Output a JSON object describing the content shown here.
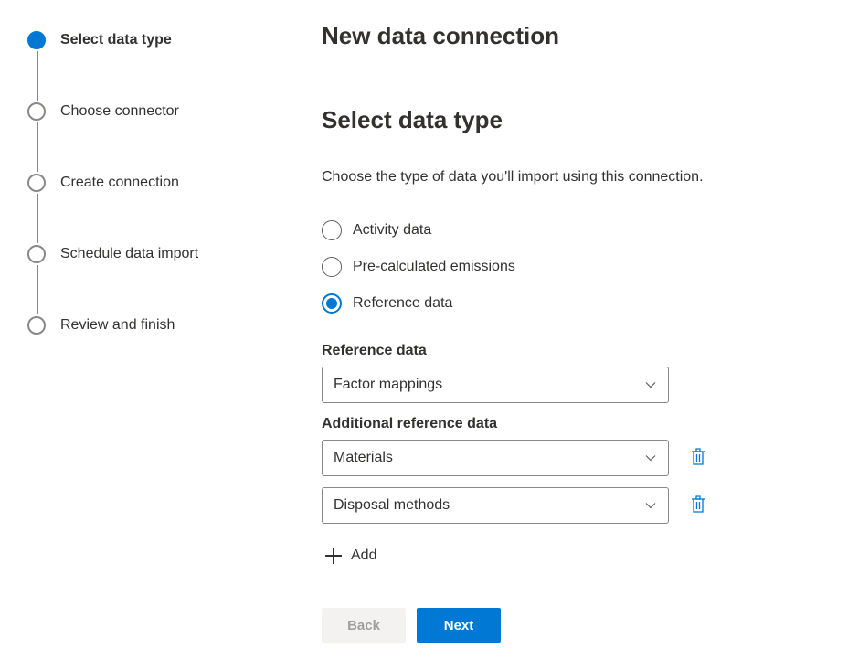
{
  "header": {
    "title": "New data connection"
  },
  "steps": [
    {
      "label": "Select data type",
      "current": true
    },
    {
      "label": "Choose connector",
      "current": false
    },
    {
      "label": "Create connection",
      "current": false
    },
    {
      "label": "Schedule data import",
      "current": false
    },
    {
      "label": "Review and finish",
      "current": false
    }
  ],
  "section": {
    "title": "Select data type",
    "description": "Choose the type of data you'll import using this connection."
  },
  "radios": {
    "activity": "Activity data",
    "precalc": "Pre-calculated emissions",
    "reference": "Reference data",
    "selected": "reference"
  },
  "reference": {
    "label": "Reference data",
    "value": "Factor mappings"
  },
  "additional": {
    "label": "Additional reference data",
    "rows": [
      {
        "value": "Materials"
      },
      {
        "value": "Disposal methods"
      }
    ],
    "add_label": "Add"
  },
  "footer": {
    "back": "Back",
    "next": "Next"
  }
}
